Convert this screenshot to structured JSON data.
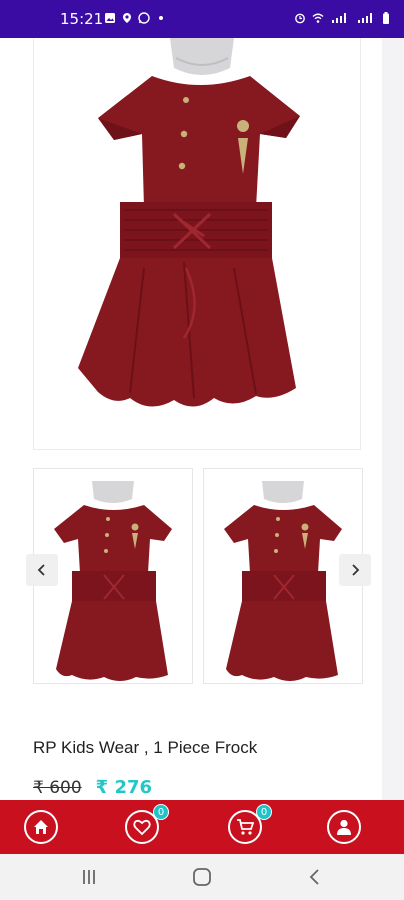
{
  "status_bar": {
    "time": "15:21",
    "left_icons": [
      "image-icon",
      "location-icon",
      "whatsapp-icon",
      "dot-icon"
    ],
    "right_icons": [
      "alarm-icon",
      "wifi-icon",
      "signal-icon",
      "signal-icon",
      "battery-icon"
    ]
  },
  "product": {
    "title": "RP Kids Wear , 1 Piece Frock",
    "price_old": "₹ 600",
    "price_new": "₹ 276"
  },
  "gallery": {
    "thumbnail_count": 2
  },
  "bottom_nav": {
    "wishlist_badge": "0",
    "cart_badge": "0",
    "items": [
      "home-icon",
      "heart-icon",
      "cart-icon",
      "user-icon"
    ]
  },
  "colors": {
    "status_bar": "#3a0ca3",
    "nav_bar": "#c8101f",
    "price_new": "#23c7c7",
    "badge": "#1ec4c8",
    "dress": "#8a1a22"
  }
}
